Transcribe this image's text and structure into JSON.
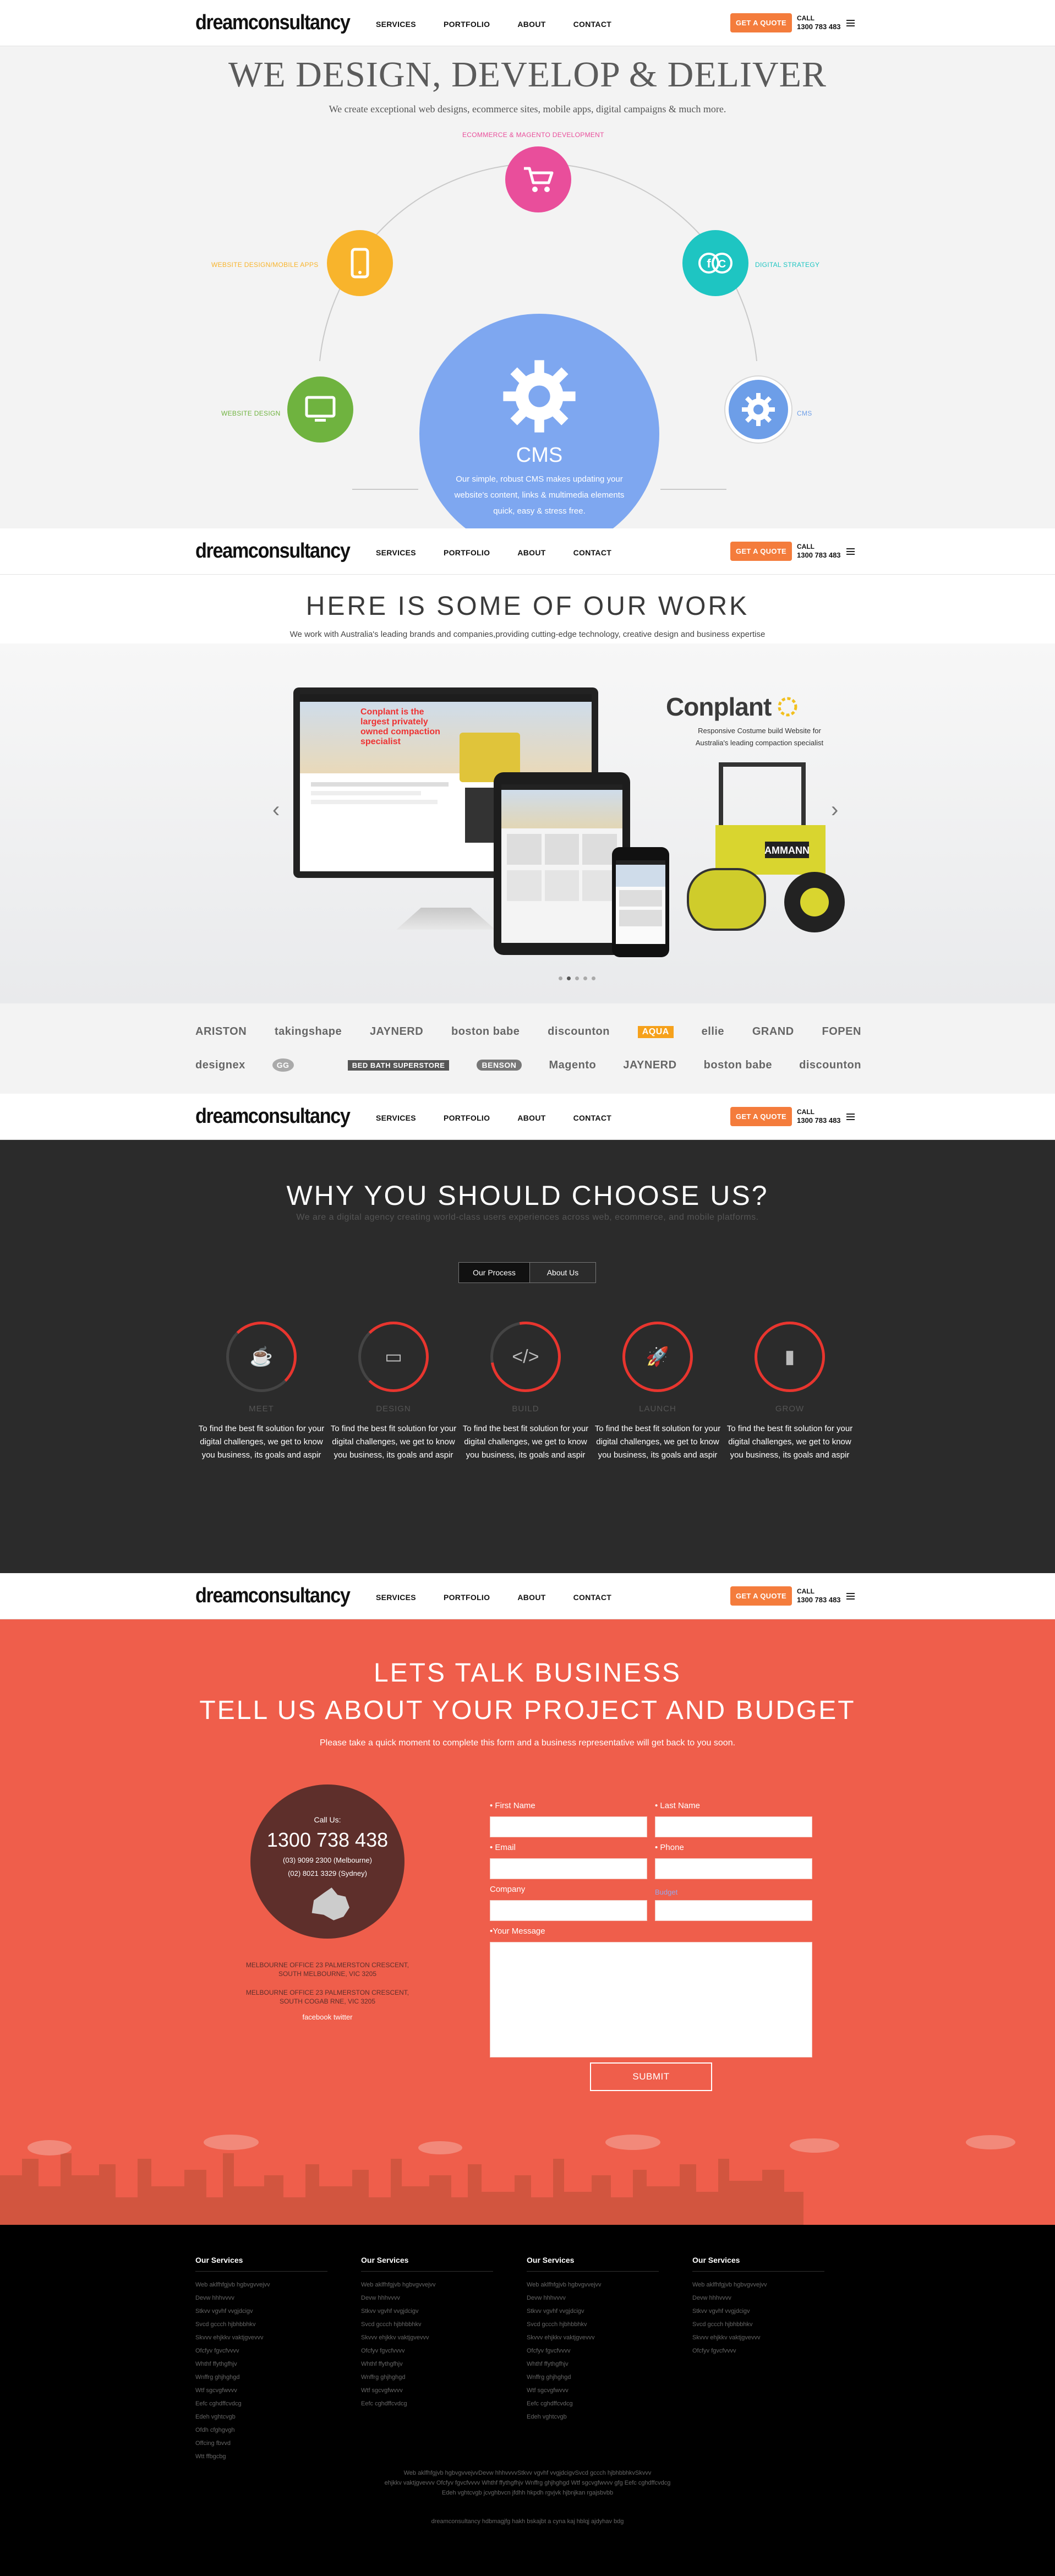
{
  "nav": {
    "logo": "dreamconsultancy",
    "items": [
      "SERVICES",
      "PORTFOLIO",
      "ABOUT",
      "CONTACT"
    ],
    "quote": "GET A QUOTE",
    "call": "CALL",
    "phone": "1300 783 483"
  },
  "hero": {
    "title": "WE DESIGN, DEVELOP & DELIVER",
    "subtitle": "We create exceptional web designs, ecommerce sites, mobile apps, digital campaigns & much more.",
    "services": [
      {
        "label": "ECOMMERCE & MAGENTO DEVELOPMENT",
        "color": "#e94e9b",
        "icon": "cart-icon"
      },
      {
        "label": "WEBSITE DESIGN/MOBILE APPS",
        "color": "#f8b42c",
        "icon": "phone-icon"
      },
      {
        "label": "DIGITAL STRATEGY",
        "color": "#1ec5c2",
        "icon": "social-icon"
      },
      {
        "label": "WEBSITE DESIGN",
        "color": "#6fb33f",
        "icon": "monitor-icon"
      },
      {
        "label": "CMS",
        "color": "#6d9ee8",
        "icon": "gear-icon"
      }
    ],
    "feature": {
      "title": "CMS",
      "text": "Our simple, robust CMS makes updating your website's content, links & multimedia elements quick, easy & stress free."
    }
  },
  "work": {
    "title": "HERE IS SOME OF OUR WORK",
    "subtitle": "We work with Australia's leading brands and companies,providing cutting-edge technology, creative design and business expertise",
    "slide": {
      "brand": "Conplant",
      "caption": "Responsive Costume build Website for Australia's leading compaction specialist",
      "screen_text": "Conplant is the largest privately owned compaction specialist"
    },
    "logos_row1": [
      "ARISTON",
      "takingshape",
      "JAYNERD",
      "boston babe",
      "discounton",
      "AQUA",
      "ellie",
      "GRAND",
      "FOPEN"
    ],
    "logos_row2": [
      "designex",
      "GG",
      "",
      "BED BATH SUPERSTORE",
      "BENSON",
      "Magento",
      "JAYNERD",
      "boston babe",
      "discounton"
    ]
  },
  "why": {
    "title": "WHY YOU SHOULD CHOOSE US?",
    "subtitle": "We are a digital agency creating world-class users experiences across web, ecommerce, and mobile platforms.",
    "tabs": [
      "Our Process",
      "About Us"
    ],
    "steps": [
      {
        "label": "MEET",
        "icon": "coffee-icon",
        "glyph": "☕",
        "text": "To find the best fit solution for your digital challenges, we get to know you business, its goals and aspir"
      },
      {
        "label": "DESIGN",
        "icon": "laptop-icon",
        "glyph": "▭",
        "text": "To find the best fit solution for your digital challenges, we get to know you business, its goals and aspir"
      },
      {
        "label": "BUILD",
        "icon": "code-icon",
        "glyph": "</>",
        "text": "To find the best fit solution for your digital challenges, we get to know you business, its goals and aspir"
      },
      {
        "label": "LAUNCH",
        "icon": "rocket-icon",
        "glyph": "🚀",
        "text": "To find the best fit solution for your digital challenges, we get to know you business, its goals and aspir"
      },
      {
        "label": "GROW",
        "icon": "chart-icon",
        "glyph": "▮",
        "text": "To find the best fit solution for your digital challenges, we get to know you business, its goals and aspir"
      }
    ]
  },
  "contact": {
    "title1": "LETS TALK BUSINESS",
    "title2": "TELL US ABOUT YOUR PROJECT AND BUDGET",
    "subtitle": "Please take a quick moment to complete this form and a business representative will get back to you soon.",
    "call_us": "Call Us:",
    "phone": "1300 738 438",
    "melbourne": "(03) 9099 2300 (Melbourne)",
    "sydney": "(02) 8021 3329 (Sydney)",
    "office1": "MELBOURNE OFFICE 23 PALMERSTON CRESCENT, SOUTH MELBOURNE, VIC 3205",
    "office2": "MELBOURNE OFFICE 23 PALMERSTON CRESCENT, SOUTH COGAB RNE, VIC 3205",
    "social": "facebook twitter",
    "labels": {
      "first": "• First Name",
      "last": "• Last Name",
      "email": "• Email",
      "phone": "• Phone",
      "company": "Company",
      "budget": "Budget",
      "message": "•Your Message"
    },
    "submit": "SUBMIT"
  },
  "footer": {
    "columns": [
      {
        "title": "Our Services",
        "items": [
          "Web aklfhfgjvb hgbvgvvejvv",
          "Devw hhhvvvv",
          "Stkvv vgvhf vvgjdcigv",
          "Svcd gccch hjbhbbhkv",
          "Skvvv ehjkkv vaktjgvevvv",
          "Ofcfyv fgvcfvvvv",
          "Whthf ffythgfhjv",
          "Wnffrg ghjhghgd",
          "Wtf sgcvgfwvvv",
          "Eefc cghdffcvdcg",
          "Edeh vghtcvgb",
          "Ofdh cfghgvgh",
          "Offcing fbvvd",
          "Wtt ffbgcbg"
        ]
      },
      {
        "title": "Our Services",
        "items": [
          "Web aklfhfgjvb hgbvgvvejvv",
          "Devw hhhvvvv",
          "Stkvv vgvhf vvgjdcigv",
          "Svcd gccch hjbhbbhkv",
          "Skvvv ehjkkv vaktjgvevvv",
          "Ofcfyv fgvcfvvvv",
          "Whthf ffythgfhjv",
          "Wnffrg ghjhghgd",
          "Wtf sgcvgfwvvv",
          "Eefc cghdffcvdcg"
        ]
      },
      {
        "title": "Our Services",
        "items": [
          "Web aklfhfgjvb hgbvgvvejvv",
          "Devw hhhvvvv",
          "Stkvv vgvhf vvgjdcigv",
          "Svcd gccch hjbhbbhkv",
          "Skvvv ehjkkv vaktjgvevvv",
          "Ofcfyv fgvcfvvvv",
          "Whthf ffythgfhjv",
          "Wnffrg ghjhghgd",
          "Wtf sgcvgfwvvv",
          "Eefc cghdffcvdcg",
          "Edeh vghtcvgb"
        ]
      },
      {
        "title": "Our Services",
        "items": [
          "Web aklfhfgjvb hgbvgvvejvv",
          "Devw hhhvvvv",
          "Stkvv vgvhf vvgjdcigv",
          "Svcd gccch hjbhbbhkv",
          "Skvvv ehjkkv vaktjgvevvv",
          "Ofcfyv fgvcfvvvv"
        ]
      }
    ],
    "links_line1": "Web aklfhfgjvb hgbvgvvejvvDevw hhhvvvvStkvv vgvhf vvgjdcigvSvcd gccch hjbhbbhkvSkvvv",
    "links_line2": "ehjkkv vaktjgvevvv Ofcfyv fgvcfvvvv Whthf ffythgfhjv Wnffrg ghjhghgd Wtf sgcvgfwvvv gfg Eefc cghdffcvdcg",
    "links_line3": "Edeh vghtcvgb jcvghbvcn jfdhh hkpdh rgvjvk hjbnjkan rgajsbvbb",
    "copyright": "dreamconsultancy hdbmagjfg hakh bskajbt a cyna kaj hblqj ajdyhav bdg"
  }
}
